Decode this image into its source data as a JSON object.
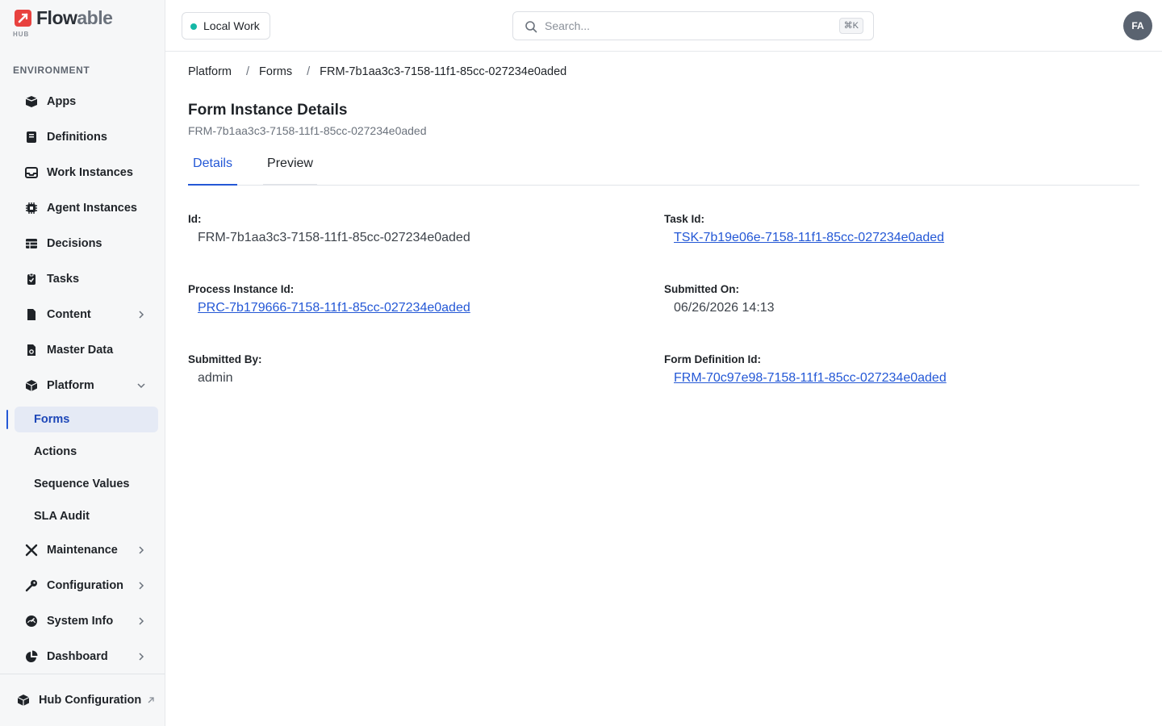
{
  "brand": {
    "name_primary": "Flow",
    "name_secondary": "able",
    "sub": "HUB",
    "color": "#e8423f"
  },
  "sidebar": {
    "section_label": "ENVIRONMENT",
    "items": [
      {
        "label": "Apps",
        "icon": "box-icon"
      },
      {
        "label": "Definitions",
        "icon": "book-icon"
      },
      {
        "label": "Work Instances",
        "icon": "inbox-icon"
      },
      {
        "label": "Agent Instances",
        "icon": "chip-icon"
      },
      {
        "label": "Decisions",
        "icon": "table-icon"
      },
      {
        "label": "Tasks",
        "icon": "clipboard-check-icon"
      },
      {
        "label": "Content",
        "icon": "document-icon",
        "expandable": true
      },
      {
        "label": "Master Data",
        "icon": "database-doc-icon"
      },
      {
        "label": "Platform",
        "icon": "cube-icon",
        "expanded": true
      }
    ],
    "platform_children": [
      {
        "label": "Forms",
        "active": true
      },
      {
        "label": "Actions"
      },
      {
        "label": "Sequence Values"
      },
      {
        "label": "SLA Audit"
      }
    ],
    "items_after": [
      {
        "label": "Maintenance",
        "icon": "tools-icon"
      },
      {
        "label": "Configuration",
        "icon": "key-icon"
      },
      {
        "label": "System Info",
        "icon": "gauge-icon"
      },
      {
        "label": "Dashboard",
        "icon": "pie-chart-icon"
      }
    ],
    "footer": {
      "label": "Hub Configuration",
      "icon": "cube-icon"
    }
  },
  "header": {
    "environment": "Local Work",
    "environment_status_color": "#14b8a6",
    "search_placeholder": "Search...",
    "search_shortcut": "⌘K",
    "avatar_initials": "FA"
  },
  "breadcrumb": [
    "Platform",
    "Forms",
    "FRM-7b1aa3c3-7158-11f1-85cc-027234e0aded"
  ],
  "page": {
    "title": "Form Instance Details",
    "subtitle": "FRM-7b1aa3c3-7158-11f1-85cc-027234e0aded",
    "tabs": [
      {
        "label": "Details",
        "active": true
      },
      {
        "label": "Preview",
        "active": false
      }
    ]
  },
  "fields": {
    "id": {
      "label": "Id:",
      "value": "FRM-7b1aa3c3-7158-11f1-85cc-027234e0aded"
    },
    "task_id": {
      "label": "Task Id:",
      "value": "TSK-7b19e06e-7158-11f1-85cc-027234e0aded"
    },
    "process_instance_id": {
      "label": "Process Instance Id:",
      "value": "PRC-7b179666-7158-11f1-85cc-027234e0aded"
    },
    "submitted_on": {
      "label": "Submitted On:",
      "value": "06/26/2026 14:13"
    },
    "submitted_by": {
      "label": "Submitted By:",
      "value": "admin"
    },
    "form_definition_id": {
      "label": "Form Definition Id:",
      "value": "FRM-70c97e98-7158-11f1-85cc-027234e0aded"
    }
  },
  "colors": {
    "accent": "#2458d6",
    "active_bg": "#e5eaf5",
    "sidebar_bg": "#f6f7f8"
  }
}
